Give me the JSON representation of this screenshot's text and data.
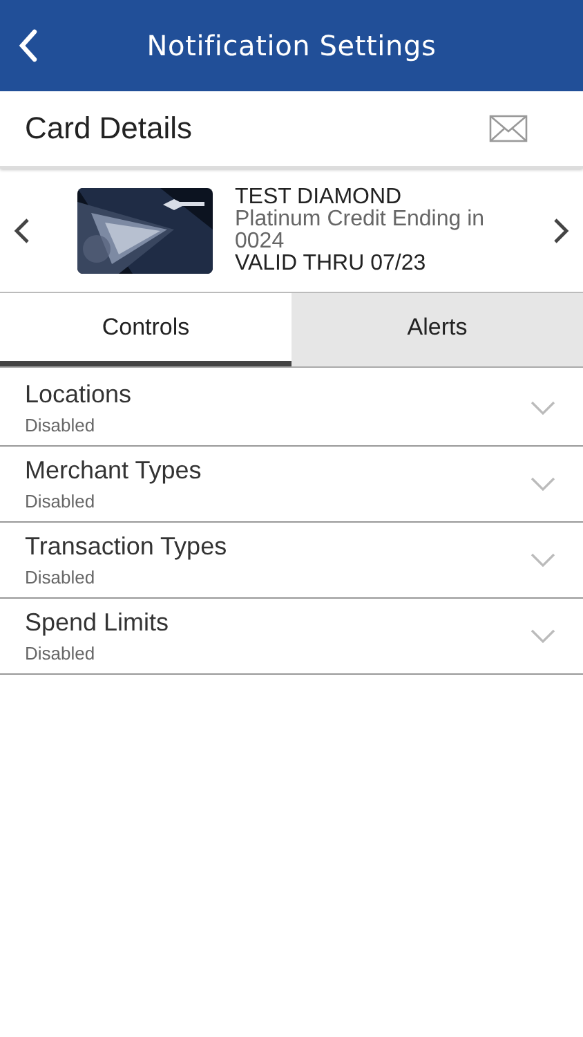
{
  "header": {
    "title": "Notification Settings"
  },
  "section": {
    "title": "Card Details"
  },
  "card": {
    "name": "TEST DIAMOND",
    "description": "Platinum Credit Ending in 0024",
    "valid": "VALID THRU 07/23"
  },
  "tabs": [
    {
      "label": "Controls",
      "selected": true
    },
    {
      "label": "Alerts",
      "selected": false
    }
  ],
  "controls": [
    {
      "title": "Locations",
      "status": "Disabled",
      "expanded": false
    },
    {
      "title": "Merchant Types",
      "status": "Disabled",
      "expanded": false
    },
    {
      "title": "Transaction Types",
      "status": "Disabled",
      "expanded": false
    },
    {
      "title": "Spend Limits",
      "status": "Disabled",
      "expanded": false
    }
  ]
}
